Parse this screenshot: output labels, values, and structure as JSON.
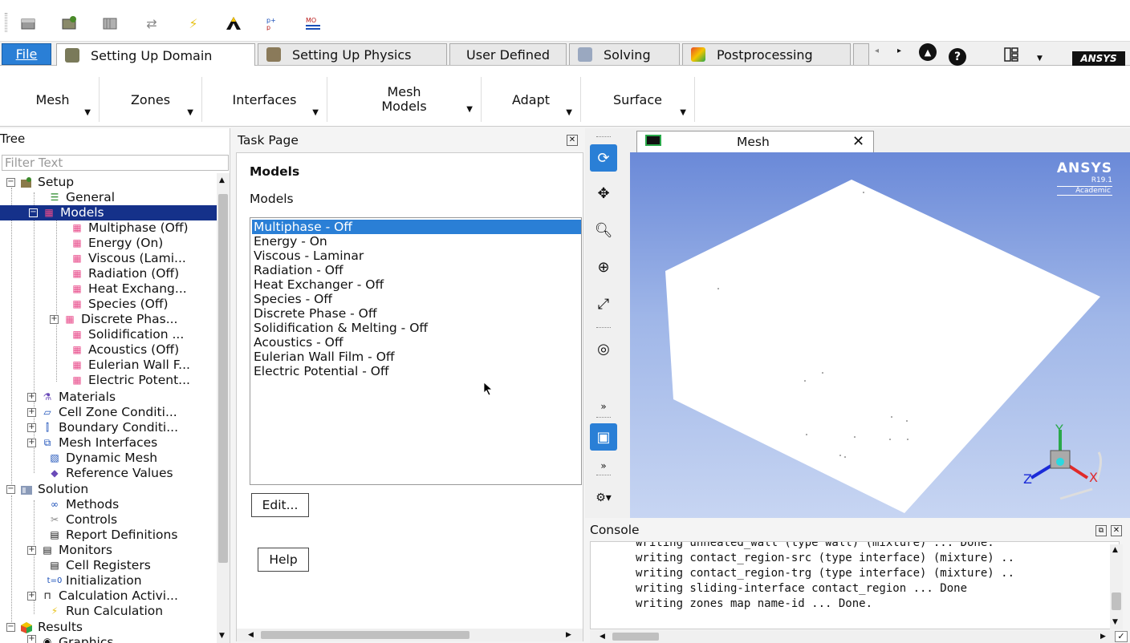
{
  "toolbar": {
    "icons": [
      "open-case-icon",
      "save-case-icon",
      "read-data-icon",
      "refresh-icon",
      "lightning-icon",
      "ansys-logo-icon",
      "parameters-icon",
      "journal-icon"
    ]
  },
  "tabs": {
    "file": "File",
    "setting_up_domain": "Setting Up Domain",
    "setting_up_physics": "Setting Up Physics",
    "user_defined": "User Defined",
    "solving": "Solving",
    "postprocessing": "Postprocessing",
    "brand": "ANSYS"
  },
  "ribbon": {
    "mesh": "Mesh",
    "zones": "Zones",
    "interfaces": "Interfaces",
    "mesh_models_1": "Mesh",
    "mesh_models_2": "Models",
    "adapt": "Adapt",
    "surface": "Surface"
  },
  "tree": {
    "title": "Tree",
    "filter_placeholder": "Filter Text",
    "nodes": {
      "setup": "Setup",
      "general": "General",
      "models": "Models",
      "multiphase": "Multiphase (Off)",
      "energy": "Energy (On)",
      "viscous": "Viscous (Lami...",
      "radiation": "Radiation (Off)",
      "heat_exchanger": "Heat Exchang...",
      "species": "Species (Off)",
      "discrete_phase": "Discrete Phas...",
      "solidification": "Solidification ...",
      "acoustics": "Acoustics (Off)",
      "eulerian_wall": "Eulerian Wall F...",
      "electric_potential": "Electric Potent...",
      "materials": "Materials",
      "cell_zone": "Cell Zone Conditi...",
      "boundary": "Boundary Conditi...",
      "mesh_interfaces": "Mesh Interfaces",
      "dynamic_mesh": "Dynamic Mesh",
      "reference_values": "Reference Values",
      "solution": "Solution",
      "methods": "Methods",
      "controls": "Controls",
      "report_definitions": "Report Definitions",
      "monitors": "Monitors",
      "cell_registers": "Cell Registers",
      "initialization": "Initialization",
      "calculation_activities": "Calculation Activi...",
      "run_calculation": "Run Calculation",
      "results": "Results",
      "graphics": "Graphics"
    }
  },
  "task_page": {
    "title": "Task Page",
    "heading": "Models",
    "list_label": "Models",
    "items": [
      "Multiphase - Off",
      "Energy - On",
      "Viscous - Laminar",
      "Radiation - Off",
      "Heat Exchanger - Off",
      "Species - Off",
      "Discrete Phase - Off",
      "Solidification & Melting - Off",
      "Acoustics - Off",
      "Eulerian Wall Film - Off",
      "Electric Potential - Off"
    ],
    "edit_button": "Edit...",
    "help_button": "Help"
  },
  "graphics": {
    "tab_title": "Mesh",
    "logo_main": "ANSYS",
    "logo_version": "R19.1",
    "logo_edition": "Academic",
    "axis_x": "X",
    "axis_y": "Y",
    "axis_z": "Z"
  },
  "console": {
    "title": "Console",
    "lines": [
      "writing unheated_wall (type wall) (mixture) ... Done.",
      "writing contact_region-src (type interface) (mixture) ..",
      "writing contact_region-trg (type interface) (mixture) ..",
      "writing sliding-interface contact_region ... Done",
      "writing zones map name-id ... Done."
    ]
  },
  "colors": {
    "selection": "#15318a",
    "accent": "#2a7fd6",
    "viewport_top": "#6a89d8",
    "viewport_bottom": "#c7d5f2"
  }
}
